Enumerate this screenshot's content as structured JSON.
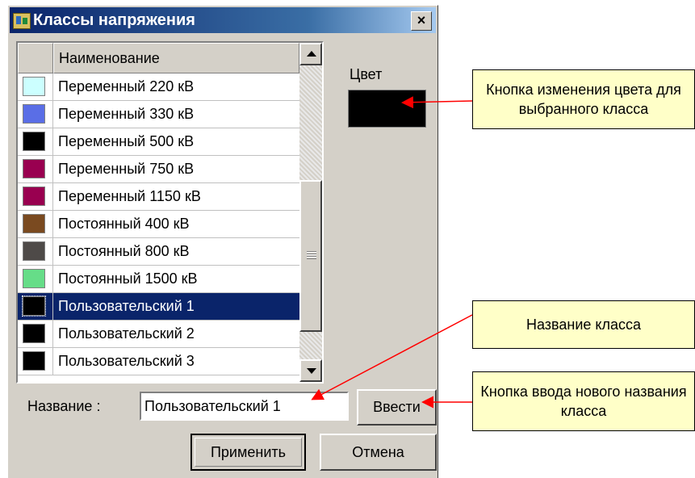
{
  "dialog": {
    "title": "Классы напряжения",
    "close_label": "×"
  },
  "list": {
    "column_header": "Наименование",
    "rows": [
      {
        "name": "Переменный 220 кВ",
        "color": "#ccffff"
      },
      {
        "name": "Переменный 330 кВ",
        "color": "#5a6ee6"
      },
      {
        "name": "Переменный 500 кВ",
        "color": "#000000"
      },
      {
        "name": "Переменный 750 кВ",
        "color": "#990050"
      },
      {
        "name": "Переменный 1150 кВ",
        "color": "#990050"
      },
      {
        "name": "Постоянный 400 кВ",
        "color": "#7a4a20"
      },
      {
        "name": "Постоянный 800 кВ",
        "color": "#4e4a48"
      },
      {
        "name": "Постоянный 1500 кВ",
        "color": "#66dd88"
      },
      {
        "name": "Пользовательский 1",
        "color": "#000000",
        "selected": true
      },
      {
        "name": "Пользовательский 2",
        "color": "#000000"
      },
      {
        "name": "Пользовательский 3",
        "color": "#000000"
      }
    ]
  },
  "color_section": {
    "label": "Цвет",
    "current_color": "#000000"
  },
  "name_row": {
    "label": "Название :",
    "value": "Пользовательский 1",
    "enter_button": "Ввести"
  },
  "buttons": {
    "apply": "Применить",
    "cancel": "Отмена"
  },
  "callouts": {
    "color_button": "Кнопка изменения цвета для выбранного класса",
    "class_name": "Название класса",
    "enter_button": "Кнопка ввода нового названия класса"
  },
  "colors": {
    "titlebar": "#0a246a",
    "selection": "#0a246a",
    "callout_bg": "#ffffc8",
    "arrow": "#ff0000"
  }
}
